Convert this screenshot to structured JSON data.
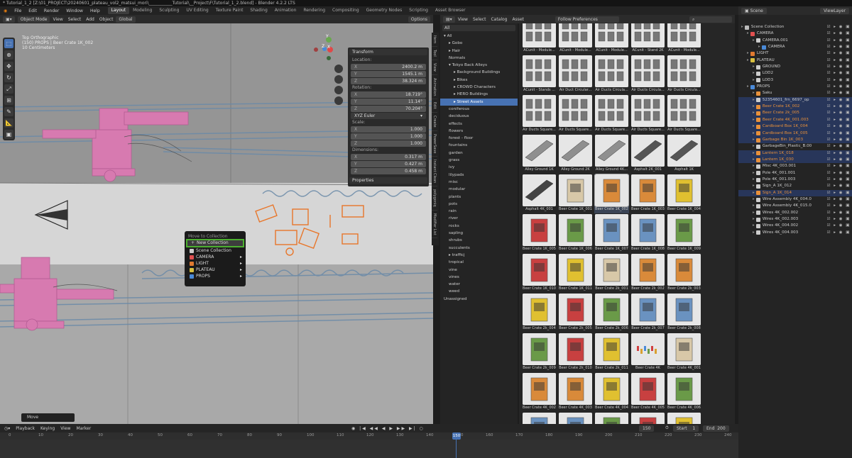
{
  "title": "* Tutorial_1_2 [Z:\\01_PROJECT\\20240601_plateau_vol2_matsui_mori\\___________Tutorial\\__Project\\F\\Tutorial_1_2.blend] - Blender 4.2.2 LTS",
  "menus": [
    "File",
    "Edit",
    "Render",
    "Window",
    "Help"
  ],
  "workspaces": [
    "Layout",
    "Modeling",
    "Sculpting",
    "UV Editing",
    "Texture Paint",
    "Shading",
    "Animation",
    "Rendering",
    "Compositing",
    "Geometry Nodes",
    "Scripting",
    "Asset Browser"
  ],
  "active_workspace": "Layout",
  "viewport": {
    "mode": "Object Mode",
    "menus": [
      "View",
      "Select",
      "Add",
      "Object"
    ],
    "orientation": "Global",
    "options": "Options",
    "overlay_lines": [
      "Top Orthographic",
      "(150) PROPS | Beer Crate 1K_002",
      "10 Centimeters"
    ],
    "axes": {
      "x": "X",
      "y": "Y",
      "z": "Z"
    },
    "tools": [
      "select",
      "cursor",
      "move",
      "rotate",
      "scale",
      "transform",
      "annotate",
      "measure",
      "add-cube"
    ],
    "last_operator": "Move"
  },
  "npanel": {
    "header": "Transform",
    "location_label": "Location:",
    "location": [
      {
        "axis": "X",
        "value": "2400.2 m"
      },
      {
        "axis": "Y",
        "value": "1545.1 m"
      },
      {
        "axis": "Z",
        "value": "38.324 m"
      }
    ],
    "rotation_label": "Rotation:",
    "rotation": [
      {
        "axis": "X",
        "value": "18.719°"
      },
      {
        "axis": "Y",
        "value": "11.14°"
      },
      {
        "axis": "Z",
        "value": "70.204°"
      }
    ],
    "rotation_mode": "XYZ Euler",
    "scale_label": "Scale:",
    "scale": [
      {
        "axis": "X",
        "value": "1.000"
      },
      {
        "axis": "Y",
        "value": "1.000"
      },
      {
        "axis": "Z",
        "value": "1.000"
      }
    ],
    "dimensions_label": "Dimensions:",
    "dimensions": [
      {
        "axis": "X",
        "value": "0.317 m"
      },
      {
        "axis": "Y",
        "value": "0.427 m"
      },
      {
        "axis": "Z",
        "value": "0.458 m"
      }
    ],
    "properties": "Properties"
  },
  "sidetabs": [
    "Item",
    "Tool",
    "View",
    "Animation",
    "Edit",
    "Create",
    "PowerSave",
    "Instant Clean",
    "polygoniq",
    "Modifier List"
  ],
  "context_menu": {
    "title": "Move to Collection",
    "highlight": "New Collection",
    "items": [
      {
        "label": "Scene Collection",
        "color": "#cccccc"
      },
      {
        "label": "CAMERA",
        "color": "#e05050"
      },
      {
        "label": "LIGHT",
        "color": "#e07a30"
      },
      {
        "label": "PLATEAU",
        "color": "#d8c040"
      },
      {
        "label": "PROPS",
        "color": "#4a8ad8"
      }
    ]
  },
  "asset_browser": {
    "menus": [
      "View",
      "Select",
      "Catalog",
      "Asset"
    ],
    "library": "All",
    "import": "Follow Preferences",
    "search_placeholder": "",
    "tree": [
      {
        "label": "All",
        "indent": 0,
        "arrow": "v"
      },
      {
        "label": "Gobo",
        "indent": 1,
        "arrow": ">"
      },
      {
        "label": "Hair",
        "indent": 1,
        "arrow": ">"
      },
      {
        "label": "Normals",
        "indent": 1,
        "arrow": ""
      },
      {
        "label": "Tokyo Back Alleys",
        "indent": 1,
        "arrow": "v"
      },
      {
        "label": "Background Buildings",
        "indent": 2,
        "arrow": ">"
      },
      {
        "label": "Bikes",
        "indent": 2,
        "arrow": ">"
      },
      {
        "label": "CROWD Characters",
        "indent": 2,
        "arrow": ">"
      },
      {
        "label": "HERO Buildings",
        "indent": 2,
        "arrow": ">"
      },
      {
        "label": "Street Assets",
        "indent": 2,
        "arrow": ">",
        "sel": true
      },
      {
        "label": "coniferous",
        "indent": 1,
        "arrow": ""
      },
      {
        "label": "deciduous",
        "indent": 1,
        "arrow": ""
      },
      {
        "label": "effects",
        "indent": 1,
        "arrow": ""
      },
      {
        "label": "flowers",
        "indent": 1,
        "arrow": ""
      },
      {
        "label": "forest - floor",
        "indent": 1,
        "arrow": ""
      },
      {
        "label": "fountains",
        "indent": 1,
        "arrow": ""
      },
      {
        "label": "garden",
        "indent": 1,
        "arrow": ""
      },
      {
        "label": "grass",
        "indent": 1,
        "arrow": ""
      },
      {
        "label": "ivy",
        "indent": 1,
        "arrow": ""
      },
      {
        "label": "lilypads",
        "indent": 1,
        "arrow": ""
      },
      {
        "label": "misc",
        "indent": 1,
        "arrow": ""
      },
      {
        "label": "modular",
        "indent": 1,
        "arrow": ""
      },
      {
        "label": "plants",
        "indent": 1,
        "arrow": ""
      },
      {
        "label": "pots",
        "indent": 1,
        "arrow": ""
      },
      {
        "label": "rain",
        "indent": 1,
        "arrow": ""
      },
      {
        "label": "river",
        "indent": 1,
        "arrow": ""
      },
      {
        "label": "rocks",
        "indent": 1,
        "arrow": ""
      },
      {
        "label": "sapling",
        "indent": 1,
        "arrow": ""
      },
      {
        "label": "shrubs",
        "indent": 1,
        "arrow": ""
      },
      {
        "label": "succulents",
        "indent": 1,
        "arrow": ""
      },
      {
        "label": "trafficj",
        "indent": 1,
        "arrow": ">"
      },
      {
        "label": "tropical",
        "indent": 1,
        "arrow": ""
      },
      {
        "label": "vine",
        "indent": 1,
        "arrow": ""
      },
      {
        "label": "vines",
        "indent": 1,
        "arrow": ""
      },
      {
        "label": "water",
        "indent": 1,
        "arrow": ""
      },
      {
        "label": "weed",
        "indent": 1,
        "arrow": ""
      },
      {
        "label": "Unassigned",
        "indent": 0,
        "arrow": ""
      }
    ],
    "assets": [
      {
        "name": "ACunit - Module...",
        "kind": "ac",
        "color": "#bdbdbd"
      },
      {
        "name": "ACunit - Module...",
        "kind": "ac",
        "color": "#bdbdbd"
      },
      {
        "name": "ACunit - Module...",
        "kind": "ac",
        "color": "#bdbdbd"
      },
      {
        "name": "ACunit - Stand 2K",
        "kind": "ac",
        "color": "#bdbdbd"
      },
      {
        "name": "ACunit - Module...",
        "kind": "ac",
        "color": "#bdbdbd"
      },
      {
        "name": "ACunit - Stands ...",
        "kind": "ac",
        "color": "#bdbdbd"
      },
      {
        "name": "Air Duct Circular...",
        "kind": "ac",
        "color": "#bdbdbd"
      },
      {
        "name": "Air Ducts Circula...",
        "kind": "ac",
        "color": "#bdbdbd"
      },
      {
        "name": "Air Ducts Circula...",
        "kind": "ac",
        "color": "#bdbdbd"
      },
      {
        "name": "Air Ducts Circula...",
        "kind": "ac",
        "color": "#bdbdbd"
      },
      {
        "name": "Air Ducts Square...",
        "kind": "ac",
        "color": "#bdbdbd"
      },
      {
        "name": "Air Ducts Square...",
        "kind": "ac",
        "color": "#bdbdbd"
      },
      {
        "name": "Air Ducts Square...",
        "kind": "ac",
        "color": "#bdbdbd"
      },
      {
        "name": "Air Ducts Square...",
        "kind": "ac",
        "color": "#bdbdbd"
      },
      {
        "name": "Air Ducts Square...",
        "kind": "ac",
        "color": "#bdbdbd"
      },
      {
        "name": "Alley Ground 1K",
        "kind": "slab",
        "color": "#8f8f8f"
      },
      {
        "name": "Alley Ground 2K",
        "kind": "slab",
        "color": "#8f8f8f"
      },
      {
        "name": "Alley Ground 4K...",
        "kind": "slab",
        "color": "#8f8f8f"
      },
      {
        "name": "Asphalt 2K_001",
        "kind": "slab",
        "color": "#555555"
      },
      {
        "name": "Asphalt 1K",
        "kind": "slab",
        "color": "#555555"
      },
      {
        "name": "Asphalt 4K_001",
        "kind": "slab",
        "color": "#444444"
      },
      {
        "name": "Beer Crate 1K_001",
        "kind": "crate",
        "color": "#d8c8a8"
      },
      {
        "name": "Beer Crate 1K_002",
        "kind": "crate",
        "color": "#d98a3a",
        "sel": true
      },
      {
        "name": "Beer Crate 1K_003",
        "kind": "crate",
        "color": "#d98a3a"
      },
      {
        "name": "Beer Crate 1K_004",
        "kind": "crate",
        "color": "#e0c030"
      },
      {
        "name": "Beer Crate 1K_005",
        "kind": "crate",
        "color": "#c84040"
      },
      {
        "name": "Beer Crate 1K_006",
        "kind": "crate",
        "color": "#6a9a48"
      },
      {
        "name": "Beer Crate 1K_007",
        "kind": "crate",
        "color": "#6a92c0"
      },
      {
        "name": "Beer Crate 1K_008",
        "kind": "crate",
        "color": "#6a92c0"
      },
      {
        "name": "Beer Crate 1K_009",
        "kind": "crate",
        "color": "#6a9a48"
      },
      {
        "name": "Beer Crate 1K_010",
        "kind": "crate",
        "color": "#c84040"
      },
      {
        "name": "Beer Crate 1K_011",
        "kind": "crate",
        "color": "#e0c030"
      },
      {
        "name": "Beer Crate 2k_001",
        "kind": "crate",
        "color": "#d8c8a8"
      },
      {
        "name": "Beer Crate 2k_002",
        "kind": "crate",
        "color": "#d98a3a"
      },
      {
        "name": "Beer Crate 2k_003",
        "kind": "crate",
        "color": "#d98a3a"
      },
      {
        "name": "Beer Crate 2k_004",
        "kind": "crate",
        "color": "#e0c030"
      },
      {
        "name": "Beer Crate 2k_005",
        "kind": "crate",
        "color": "#c84040"
      },
      {
        "name": "Beer Crate 2k_006",
        "kind": "crate",
        "color": "#6a9a48"
      },
      {
        "name": "Beer Crate 2k_007",
        "kind": "crate",
        "color": "#6a92c0"
      },
      {
        "name": "Beer Crate 2k_008",
        "kind": "crate",
        "color": "#6a92c0"
      },
      {
        "name": "Beer Crate 2k_009",
        "kind": "crate",
        "color": "#6a9a48"
      },
      {
        "name": "Beer Crate 2k_010",
        "kind": "crate",
        "color": "#c84040"
      },
      {
        "name": "Beer Crate 2k_011",
        "kind": "crate",
        "color": "#e0c030"
      },
      {
        "name": "Beer Crate 4K",
        "kind": "bottles",
        "color": "#e8e8e8"
      },
      {
        "name": "Beer Crate 4K_001",
        "kind": "crate",
        "color": "#d8c8a8"
      },
      {
        "name": "Beer Crate 4K_002",
        "kind": "crate",
        "color": "#d98a3a"
      },
      {
        "name": "Beer Crate 4K_003",
        "kind": "crate",
        "color": "#d98a3a"
      },
      {
        "name": "Beer Crate 4K_004",
        "kind": "crate",
        "color": "#e0c030"
      },
      {
        "name": "Beer Crate 4K_005",
        "kind": "crate",
        "color": "#c84040"
      },
      {
        "name": "Beer Crate 4K_006",
        "kind": "crate",
        "color": "#6a9a48"
      },
      {
        "name": "",
        "kind": "crate",
        "color": "#6a92c0"
      },
      {
        "name": "",
        "kind": "crate",
        "color": "#6a92c0"
      },
      {
        "name": "",
        "kind": "crate",
        "color": "#6a9a48"
      },
      {
        "name": "",
        "kind": "crate",
        "color": "#c84040"
      },
      {
        "name": "",
        "kind": "crate",
        "color": "#e0c030"
      }
    ]
  },
  "outliner": {
    "scene": "Scene",
    "view_layer": "ViewLayer",
    "rows": [
      {
        "label": "Scene Collection",
        "indent": 0,
        "icon": "#bbbbbb",
        "orange": false,
        "sel": false
      },
      {
        "label": "CAMERA",
        "indent": 1,
        "icon": "#e05050",
        "orange": false,
        "sel": false
      },
      {
        "label": "CAMERA.001",
        "indent": 2,
        "icon": "#cccccc",
        "orange": false,
        "sel": false
      },
      {
        "label": "CAMERA",
        "indent": 3,
        "icon": "#4a8ad8",
        "orange": false,
        "sel": false
      },
      {
        "label": "LIGHT",
        "indent": 1,
        "icon": "#e07a30",
        "orange": false,
        "sel": false
      },
      {
        "label": "PLATEAU",
        "indent": 1,
        "icon": "#d8c040",
        "orange": false,
        "sel": false
      },
      {
        "label": "GROUND",
        "indent": 2,
        "icon": "#cccccc",
        "orange": false,
        "sel": false
      },
      {
        "label": "LOD2",
        "indent": 2,
        "icon": "#cccccc",
        "orange": false,
        "sel": false
      },
      {
        "label": "LOD3",
        "indent": 2,
        "icon": "#cccccc",
        "orange": false,
        "sel": false
      },
      {
        "label": "PROPS",
        "indent": 1,
        "icon": "#4a8ad8",
        "orange": false,
        "sel": false
      },
      {
        "label": "Saku",
        "indent": 2,
        "icon": "#e8903a",
        "orange": false,
        "sel": false
      },
      {
        "label": "52354601_frn_6697_op",
        "indent": 2,
        "icon": "#cccccc",
        "orange": false,
        "sel": true
      },
      {
        "label": "Beer Crate 1K_002",
        "indent": 2,
        "icon": "#e8903a",
        "orange": true,
        "sel": true
      },
      {
        "label": "Beer Crate 2k_005",
        "indent": 2,
        "icon": "#e8903a",
        "orange": true,
        "sel": true
      },
      {
        "label": "Beer Crate 4K_001.003",
        "indent": 2,
        "icon": "#e8903a",
        "orange": true,
        "sel": true
      },
      {
        "label": "Cardboard Box 1K_004",
        "indent": 2,
        "icon": "#e8903a",
        "orange": true,
        "sel": true
      },
      {
        "label": "Cardboard Box 1K_005",
        "indent": 2,
        "icon": "#e8903a",
        "orange": true,
        "sel": true
      },
      {
        "label": "Garbage Bin 1K_003",
        "indent": 2,
        "icon": "#e8903a",
        "orange": true,
        "sel": true
      },
      {
        "label": "GarbageBin_Plastic_B.00",
        "indent": 2,
        "icon": "#cccccc",
        "orange": false,
        "sel": false
      },
      {
        "label": "Lantern 1K_018",
        "indent": 2,
        "icon": "#e8903a",
        "orange": true,
        "sel": true
      },
      {
        "label": "Lantern 1K_030",
        "indent": 2,
        "icon": "#e8903a",
        "orange": true,
        "sel": true
      },
      {
        "label": "Misc 4K_003.001",
        "indent": 2,
        "icon": "#cccccc",
        "orange": false,
        "sel": false
      },
      {
        "label": "Pole 4K_001.001",
        "indent": 2,
        "icon": "#cccccc",
        "orange": false,
        "sel": false
      },
      {
        "label": "Pole 4K_001.003",
        "indent": 2,
        "icon": "#cccccc",
        "orange": false,
        "sel": false
      },
      {
        "label": "Sign_A 1K_012",
        "indent": 2,
        "icon": "#cccccc",
        "orange": false,
        "sel": false
      },
      {
        "label": "Sign_A 1K_014",
        "indent": 2,
        "icon": "#e8903a",
        "orange": true,
        "sel": true
      },
      {
        "label": "Wire Assembly 4K_004.0",
        "indent": 2,
        "icon": "#cccccc",
        "orange": false,
        "sel": false
      },
      {
        "label": "Wire Assembly 4K_015.0",
        "indent": 2,
        "icon": "#cccccc",
        "orange": false,
        "sel": false
      },
      {
        "label": "Wires 4K_002.002",
        "indent": 2,
        "icon": "#cccccc",
        "orange": false,
        "sel": false
      },
      {
        "label": "Wires 4K_002.003",
        "indent": 2,
        "icon": "#cccccc",
        "orange": false,
        "sel": false
      },
      {
        "label": "Wires 4K_004.002",
        "indent": 2,
        "icon": "#cccccc",
        "orange": false,
        "sel": false
      },
      {
        "label": "Wires 4K_004.003",
        "indent": 2,
        "icon": "#cccccc",
        "orange": false,
        "sel": false
      }
    ]
  },
  "timeline": {
    "menus": [
      "Playback",
      "Keying",
      "View",
      "Marker"
    ],
    "current_frame": "150",
    "start_label": "Start",
    "start": "1",
    "end_label": "End",
    "end": "200",
    "ticks": [
      "0",
      "10",
      "20",
      "30",
      "40",
      "50",
      "60",
      "70",
      "80",
      "90",
      "100",
      "110",
      "120",
      "130",
      "140",
      "150",
      "160",
      "170",
      "180",
      "190",
      "200",
      "210",
      "220",
      "230",
      "240"
    ]
  }
}
